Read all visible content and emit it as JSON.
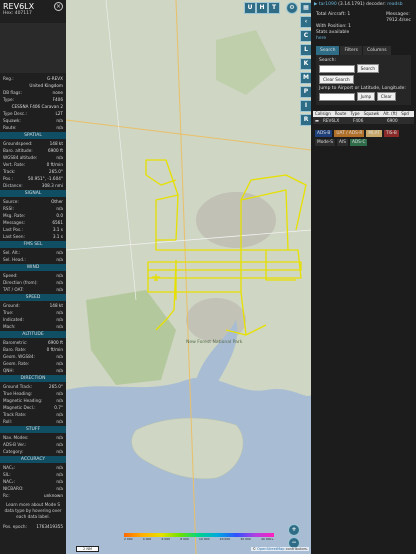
{
  "aircraft": {
    "callsign": "REV6LX",
    "hex_label": "Hex:",
    "hex": "407117"
  },
  "info_rows": [
    {
      "label": "Reg.:",
      "value": "G-REVX"
    },
    {
      "label": "",
      "value": "United Kingdom"
    },
    {
      "label": "DB flags:",
      "value": "none"
    },
    {
      "label": "Type:",
      "value": "F406"
    },
    {
      "label": "",
      "value": "CESSNA F406 Caravan 2"
    },
    {
      "label": "Type Desc.:",
      "value": "L2T"
    },
    {
      "label": "Squawk:",
      "value": "n/a"
    },
    {
      "label": "Route:",
      "value": "n/a"
    }
  ],
  "sections": {
    "spatial": {
      "title": "SPATIAL",
      "rows": [
        {
          "label": "Groundspeed:",
          "value": "148 kt"
        },
        {
          "label": "Baro. altitude:",
          "value": "6900 ft"
        },
        {
          "label": "WGS84 altitude:",
          "value": "n/a"
        },
        {
          "label": "Vert. Rate:",
          "value": "0 ft/min"
        },
        {
          "label": "Track:",
          "value": "265.0°"
        },
        {
          "label": "Pos.:",
          "value": "50.951°, -1.604°"
        },
        {
          "label": "Distance:",
          "value": "308.3 nmi"
        }
      ]
    },
    "signal": {
      "title": "SIGNAL",
      "rows": [
        {
          "label": "Source:",
          "value": "Other"
        },
        {
          "label": "RSSI:",
          "value": "n/a"
        },
        {
          "label": "Msg. Rate:",
          "value": "0.0"
        },
        {
          "label": "Messages:",
          "value": "6561"
        },
        {
          "label": "Last Pos.:",
          "value": "3.1 s"
        },
        {
          "label": "Last Seen:",
          "value": "3.1 s"
        }
      ]
    },
    "fms": {
      "title": "FMS SEL",
      "rows": [
        {
          "label": "Sel. Alt.:",
          "value": "n/a"
        },
        {
          "label": "Sel. Head.:",
          "value": "n/a"
        }
      ]
    },
    "wind": {
      "title": "WIND",
      "rows": [
        {
          "label": "Speed:",
          "value": "n/a"
        },
        {
          "label": "Direction (from):",
          "value": "n/a"
        },
        {
          "label": "TAT / OAT:",
          "value": "n/a"
        }
      ]
    },
    "speed": {
      "title": "SPEED",
      "rows": [
        {
          "label": "Ground:",
          "value": "148 kt"
        },
        {
          "label": "True:",
          "value": "n/a"
        },
        {
          "label": "Indicated:",
          "value": "n/a"
        },
        {
          "label": "Mach:",
          "value": "n/a"
        }
      ]
    },
    "altitude": {
      "title": "ALTITUDE",
      "rows": [
        {
          "label": "Barometric:",
          "value": "6900 ft"
        },
        {
          "label": "Baro. Rate:",
          "value": "0 ft/min"
        },
        {
          "label": "Geom. WGS84:",
          "value": "n/a"
        },
        {
          "label": "Geom. Rate:",
          "value": "n/a"
        },
        {
          "label": "QNH:",
          "value": "n/a"
        }
      ]
    },
    "direction": {
      "title": "DIRECTION",
      "rows": [
        {
          "label": "Ground Track:",
          "value": "265.0°"
        },
        {
          "label": "True Heading:",
          "value": "n/a"
        },
        {
          "label": "Magnetic Heading:",
          "value": "n/a"
        },
        {
          "label": "Magnetic Decl.:",
          "value": "0.7°"
        },
        {
          "label": "Track Rate:",
          "value": "n/a"
        },
        {
          "label": "Roll:",
          "value": "n/a"
        }
      ]
    },
    "stuff": {
      "title": "STUFF",
      "rows": [
        {
          "label": "Nav. Modes:",
          "value": "n/a"
        },
        {
          "label": "ADS-B Ver.:",
          "value": "n/a"
        },
        {
          "label": "Category:",
          "value": "n/a"
        }
      ]
    },
    "accuracy": {
      "title": "ACCURACY",
      "rows": [
        {
          "label": "NACₚ:",
          "value": "n/a"
        },
        {
          "label": "SIL:",
          "value": "n/a"
        },
        {
          "label": "NACᵥ:",
          "value": "n/a"
        },
        {
          "label": "NICBARO:",
          "value": "n/a"
        },
        {
          "label": "Rc:",
          "value": "unknown"
        }
      ]
    }
  },
  "note": "Learn more about Mode S data type by hovering over each data label.",
  "pos_epoch": {
    "label": "Pos. epoch:",
    "value": "1763419355"
  },
  "map": {
    "buttons": [
      "U",
      "H",
      "T"
    ],
    "side_buttons": [
      "C",
      "L",
      "K",
      "M",
      "P",
      "I",
      "R"
    ],
    "scale_label": "2 NM",
    "place_label": "New Forest National Park",
    "attribution_prefix": "© ",
    "attribution_link": "OpenStreetMap",
    "attribution_suffix": " contributors.",
    "track_color": "#e6e000"
  },
  "altitude_scale": [
    "2 000",
    "4 000",
    "6 000",
    "8 000",
    "10 000",
    "20 000",
    "30 000",
    "40 000+"
  ],
  "right_panel": {
    "app_link": "tar1090",
    "version": "(3.14.1791) decoder:",
    "decoder_link": "readsb",
    "total_aircraft_label": "Total Aircraft:",
    "total_aircraft": "1",
    "messages_label": "Messages:",
    "messages": "7912.4/sec",
    "with_position_label": "With Position:",
    "with_position": "1",
    "stats_label": "Stats available",
    "stats_link": "here",
    "tabs": [
      "Search",
      "Filters",
      "Columns"
    ],
    "search_label": "Search:",
    "search_button": "Search",
    "clear_search": "Clear Search",
    "jump_label": "Jump to Airport or Latitude, Longitude:",
    "jump_button": "Jump",
    "clear_button": "Clear",
    "columns": [
      "Callsign",
      "Route",
      "Type",
      "Squawk",
      "Alt. (ft)",
      "Spd"
    ],
    "row": {
      "callsign": "REV6LX",
      "type": "F406",
      "alt": "6900"
    },
    "source_badges": [
      {
        "label": "ADS-B",
        "color": "#1e3f7a"
      },
      {
        "label": "UAT / ADS-R",
        "color": "#b0702a"
      },
      {
        "label": "MLAT",
        "color": "#c8a86a"
      },
      {
        "label": "TIS-B",
        "color": "#8a2a2a"
      },
      {
        "label": "Mode-S",
        "color": "#2d2d2d"
      },
      {
        "label": "AIS",
        "color": "#2d2d2d"
      },
      {
        "label": "ADS-C",
        "color": "#2f6d4a"
      }
    ]
  }
}
